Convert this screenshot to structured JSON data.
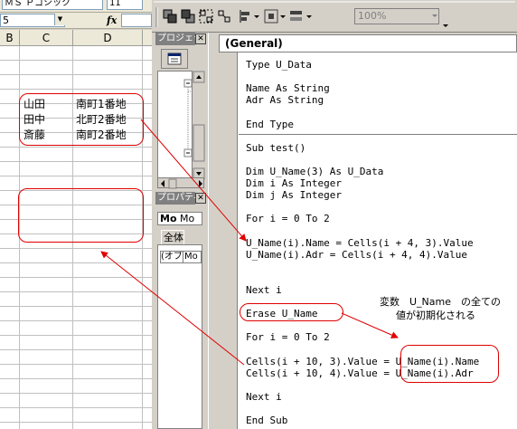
{
  "excel": {
    "font_name": "ＭＳ Ｐゴシック",
    "font_size": "11",
    "name_box": "5",
    "fx_label": "fx",
    "columns": [
      "B",
      "C",
      "D"
    ],
    "data_rows": [
      {
        "name": "山田",
        "address": "南町1番地"
      },
      {
        "name": "田中",
        "address": "北町2番地"
      },
      {
        "name": "斎藤",
        "address": "南町2番地"
      }
    ]
  },
  "vbe": {
    "zoom": "100%",
    "project_title": "プロジェクト",
    "properties_title": "プロパティ",
    "properties_object": "Mo",
    "properties_object2": "Mo",
    "properties_tab": "全体",
    "properties_row_name": "(オブ",
    "properties_row_value": "Mo",
    "procedure_combo": "(General)",
    "code_lines": [
      "Type U_Data",
      "",
      "Name As String",
      "Adr As String",
      "",
      "End Type",
      "",
      "Sub test()",
      "",
      "Dim U_Name(3) As U_Data",
      "Dim i As Integer",
      "Dim j As Integer",
      "",
      "For i = 0 To 2",
      "",
      "U_Name(i).Name = Cells(i + 4, 3).Value",
      "U_Name(i).Adr = Cells(i + 4, 4).Value",
      "",
      "",
      "Next i",
      "",
      "Erase U_Name",
      "",
      "For i = 0 To 2",
      "",
      "Cells(i + 10, 3).Value = U_Name(i).Name",
      "Cells(i + 10, 4).Value = U_Name(i).Adr",
      "",
      "Next i",
      "",
      "End Sub"
    ]
  },
  "annotation": {
    "line1": "変数　U_Name　の全ての",
    "line2": "値が初期化される"
  },
  "colors": {
    "annotation_red": "#e00000",
    "panel_gray": "#d4d0c8",
    "titlebar_gray": "#808080"
  }
}
